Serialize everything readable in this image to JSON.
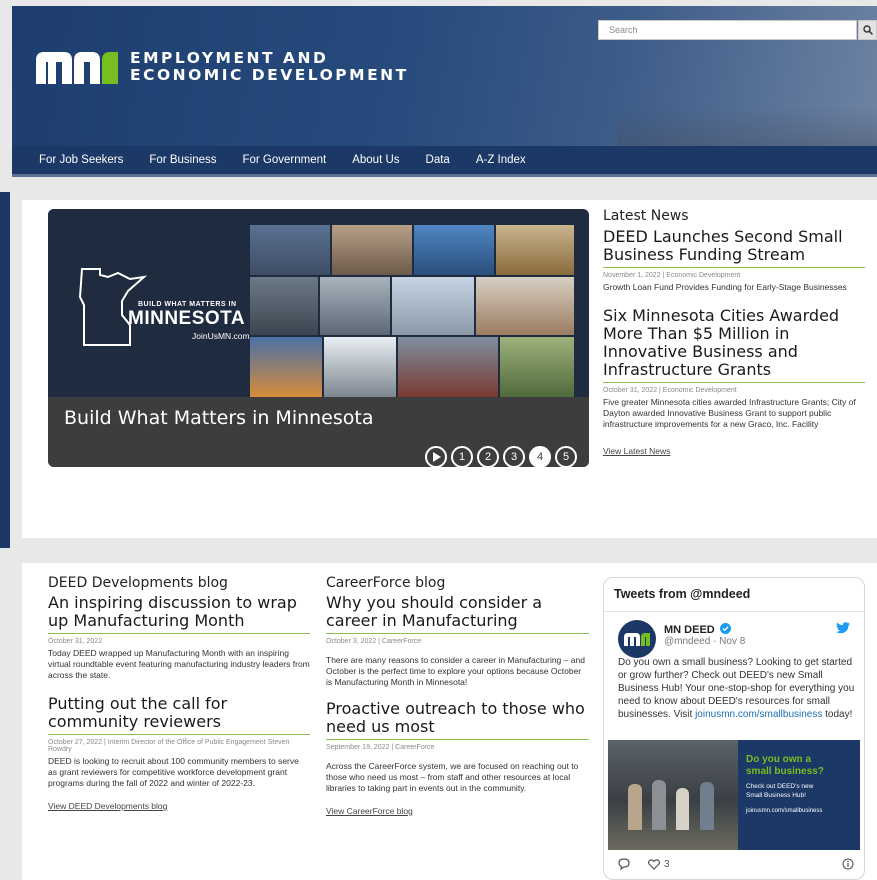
{
  "header": {
    "logo_line1": "EMPLOYMENT AND",
    "logo_line2": "ECONOMIC DEVELOPMENT",
    "search_placeholder": "Search",
    "brand_color": "#1b3866"
  },
  "nav": {
    "items": [
      "For Job Seekers",
      "For Business",
      "For Government",
      "About Us",
      "Data",
      "A-Z Index"
    ]
  },
  "slider": {
    "mn_small": "BUILD WHAT MATTERS IN",
    "mn_big": "MINNESOTA",
    "mn_url": "JoinUsMN.com",
    "title": "Build What Matters in Minnesota",
    "dots": [
      "1",
      "2",
      "3",
      "4",
      "5"
    ],
    "active_dot": "4"
  },
  "latest_news": {
    "heading": "Latest News",
    "items": [
      {
        "title": "DEED Launches Second Small Business Funding Stream",
        "meta": "November 1, 2022 | Economic Development",
        "summary": "Growth Loan Fund Provides Funding for Early-Stage Businesses"
      },
      {
        "title": "Six Minnesota Cities Awarded More Than $5 Million in Innovative Business and Infrastructure Grants",
        "meta": "October 31, 2022 | Economic Development",
        "summary": "Five greater Minnesota cities awarded Infrastructure Grants; City of Dayton awarded Innovative Business Grant to support public infrastructure improvements for a new Graco, Inc. Facility"
      }
    ],
    "link": "View Latest News"
  },
  "blog1": {
    "heading": "DEED Developments blog",
    "items": [
      {
        "title": "An inspiring discussion to wrap up Manufacturing Month",
        "meta": "October 31, 2022",
        "summary": "Today DEED wrapped up Manufacturing Month with an inspiring virtual roundtable event featuring manufacturing industry leaders from across the state."
      },
      {
        "title": "Putting out the call for community reviewers",
        "meta": "October 27, 2022 | Interim Director of the Office of Public Engagement Steven Rowdry",
        "summary": "DEED is looking to recruit about 100 community members to serve as grant reviewers for competitive workforce development grant programs during the fall of 2022 and winter of 2022-23."
      }
    ],
    "link": "View DEED Developments blog"
  },
  "blog2": {
    "heading": "CareerForce blog",
    "items": [
      {
        "title": "Why you should consider a career in Manufacturing",
        "meta": "October 3, 2022 | CareerForce",
        "summary": "There are many reasons to consider a career in Manufacturing – and October is the perfect time to explore your options because October is Manufacturing Month in Minnesota!"
      },
      {
        "title": "Proactive outreach to those who need us most",
        "meta": "September 19, 2022 | CareerForce",
        "summary": "Across the CareerForce system, we are focused on reaching out to those who need us most – from staff and other resources at local libraries to taking part in events out in the community."
      }
    ],
    "link": "View CareerForce blog"
  },
  "twitter": {
    "heading": "Tweets from @mndeed",
    "name": "MN DEED",
    "handle": "@mndeed · Nov 8",
    "text": "Do you own a small business? Looking to get started or grow further? Check out DEED's new Small Business Hub! Your one-stop-shop for everything you need to know about DEED's resources for small businesses. Visit",
    "link": "joinusmn.com/smallbusiness",
    "text_end": "today!",
    "img_head1": "Do you own a",
    "img_head2": "small business?",
    "img_sub1": "Check out DEED's new",
    "img_sub2": "Small Business Hub!",
    "img_url": "joinusmn.com/smallbusiness",
    "likes": "3"
  }
}
